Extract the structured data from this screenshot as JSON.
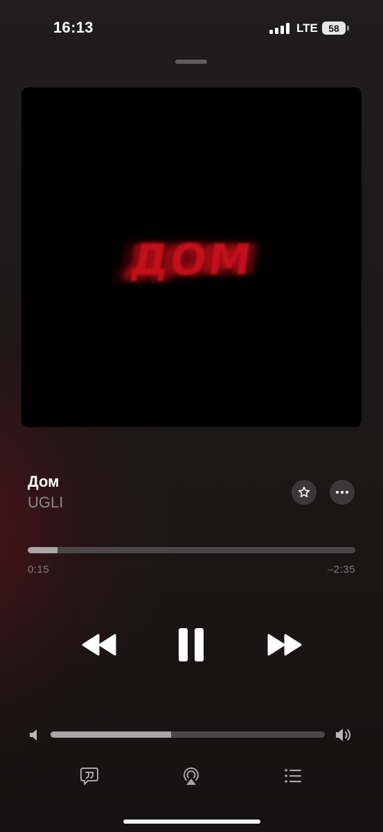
{
  "status_bar": {
    "time": "16:13",
    "network": "LTE",
    "battery": "58",
    "signal_bars": 4
  },
  "artwork": {
    "word": "ДОМ",
    "background": "#000000",
    "text_color": "#c4101a"
  },
  "track": {
    "title": "Дом",
    "artist": "UGLI"
  },
  "progress": {
    "elapsed": "0:15",
    "remaining": "–2:35",
    "fraction": 0.09
  },
  "volume": {
    "fraction": 0.44
  },
  "colors": {
    "accent_red": "#c4101a",
    "track_bg": "#4a4748",
    "track_fill": "#a8a6a7",
    "secondary_text": "#8d8a8b"
  },
  "icons": {
    "star": "star-icon",
    "more": "ellipsis-icon",
    "rewind": "rewind-icon",
    "pause": "pause-icon",
    "forward": "fast-forward-icon",
    "volume_low": "speaker-low-icon",
    "volume_high": "speaker-high-icon",
    "lyrics": "lyrics-quote-icon",
    "airplay": "airplay-audio-icon",
    "queue": "queue-list-icon"
  }
}
